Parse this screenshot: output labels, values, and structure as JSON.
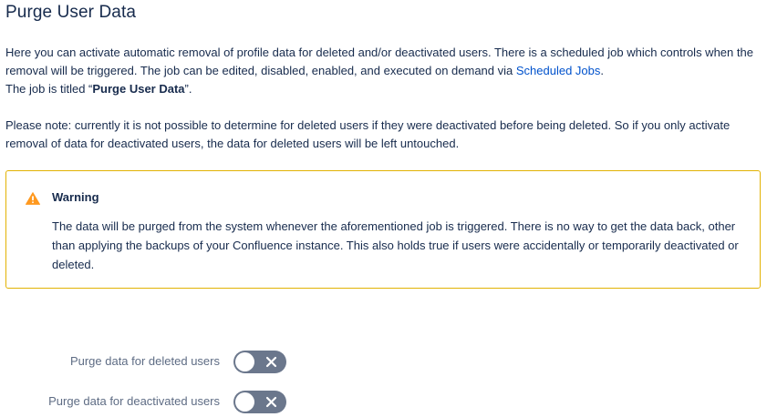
{
  "page": {
    "title": "Purge User Data"
  },
  "intro": {
    "text_before_link": "Here you can activate automatic removal of profile data for deleted and/or deactivated users. There is a scheduled job which controls when the removal will be triggered. The job can be edited, disabled, enabled, and executed on demand via ",
    "link_label": "Scheduled Jobs",
    "text_after_link": ".",
    "job_title_prefix": "The job is titled “",
    "job_title": "Purge User Data",
    "job_title_suffix": "”."
  },
  "note": {
    "text": "Please note: currently it is not possible to determine for deleted users if they were deactivated before being deleted. So if you only activate removal of data for deactivated users, the data for deleted users will be left untouched."
  },
  "warning": {
    "icon": "warning-icon",
    "title": "Warning",
    "body": "The data will be purged from the system whenever the aforementioned job is triggered. There is no way to get the data back, other than applying the backups of your Confluence instance. This also holds true if users were accidentally or temporarily deactivated or deleted."
  },
  "toggles": [
    {
      "label": "Purge data for deleted users",
      "state": "off"
    },
    {
      "label": "Purge data for deactivated users",
      "state": "off"
    }
  ],
  "colors": {
    "text": "#172b4d",
    "link": "#0052cc",
    "warning_border": "#e2b203",
    "warning_icon": "#ff991f",
    "toggle_off": "#6b778c",
    "label_muted": "#5e6c84"
  }
}
